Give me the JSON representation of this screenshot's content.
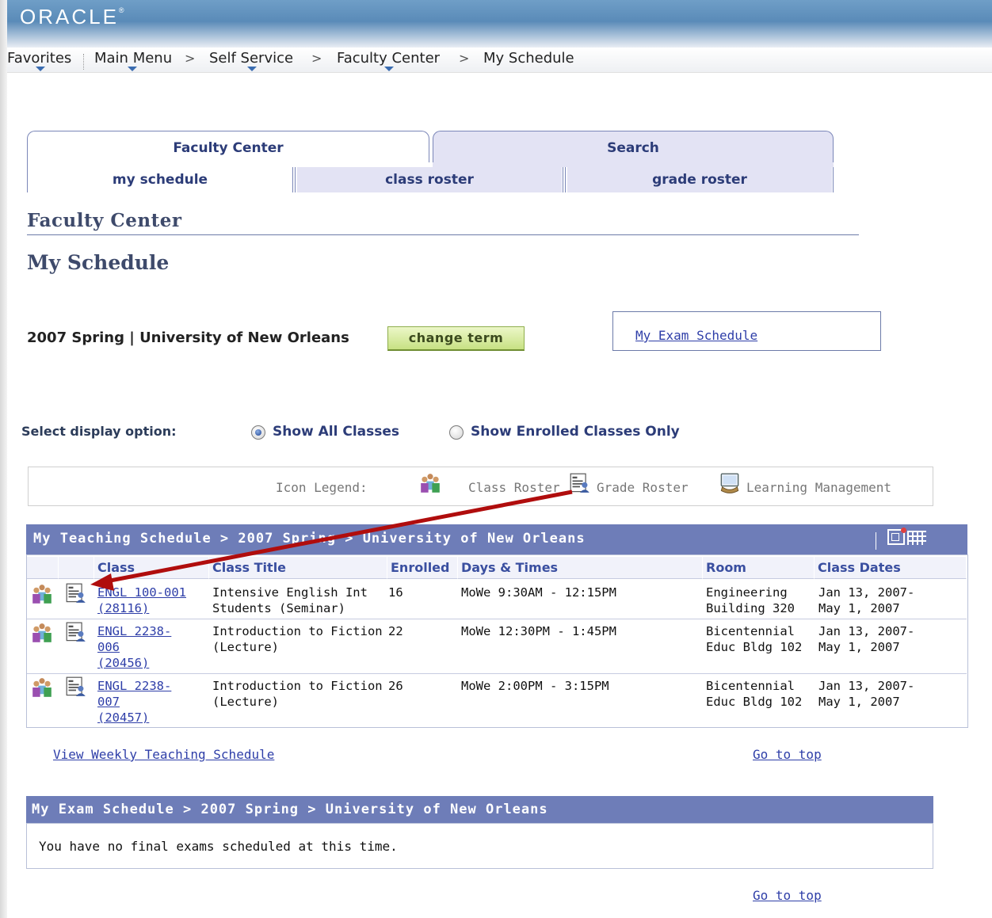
{
  "header": {
    "logo": "ORACLE",
    "logo_mark": "®"
  },
  "nav": {
    "items": [
      "Favorites",
      "Main Menu",
      "Self Service",
      "Faculty Center",
      "My Schedule"
    ],
    "separator": ">"
  },
  "tabs": {
    "top": [
      "Faculty Center",
      "Search"
    ],
    "sub": [
      "my schedule",
      "class roster",
      "grade roster"
    ]
  },
  "page": {
    "section_title": "Faculty Center",
    "title": "My Schedule",
    "term": "2007 Spring | University of New Orleans",
    "change_term": "change term",
    "exam_link": "My Exam Schedule"
  },
  "display": {
    "label": "Select display option:",
    "options": [
      "Show All Classes",
      "Show Enrolled Classes Only"
    ],
    "selected": "Show All Classes"
  },
  "legend": {
    "label": "Icon Legend:",
    "class_roster": "Class Roster",
    "grade_roster": "Grade Roster",
    "learning_management": "Learning Management"
  },
  "teaching": {
    "title": "My Teaching Schedule > 2007 Spring > University of New Orleans",
    "columns": [
      "Class",
      "Class Title",
      "Enrolled",
      "Days & Times",
      "Room",
      "Class Dates"
    ],
    "rows": [
      {
        "class": "ENGL 100-001\n(28116)",
        "title": "Intensive English Int\nStudents (Seminar)",
        "enrolled": "16",
        "days": "MoWe 9:30AM - 12:15PM",
        "room": "Engineering\nBuilding 320",
        "dates": "Jan 13, 2007-\nMay 1, 2007"
      },
      {
        "class": "ENGL 2238-\n006\n(20456)",
        "title": "Introduction to Fiction\n(Lecture)",
        "enrolled": "22",
        "days": "MoWe 12:30PM - 1:45PM",
        "room": "Bicentennial\nEduc Bldg 102",
        "dates": "Jan 13, 2007-\nMay 1, 2007"
      },
      {
        "class": "ENGL 2238-\n007\n(20457)",
        "title": "Introduction to Fiction\n(Lecture)",
        "enrolled": "26",
        "days": "MoWe 2:00PM - 3:15PM",
        "room": "Bicentennial\nEduc Bldg 102",
        "dates": "Jan 13, 2007-\nMay 1, 2007"
      }
    ]
  },
  "links": {
    "weekly": "View Weekly Teaching Schedule",
    "top": "Go to top"
  },
  "exam": {
    "title": "My Exam Schedule > 2007 Spring > University of New Orleans",
    "message": "You have no final exams scheduled at this time."
  },
  "colors": {
    "grid_header": "#6e7db8",
    "link": "#2e3ea8",
    "annotation_arrow": "#b00d0d"
  }
}
